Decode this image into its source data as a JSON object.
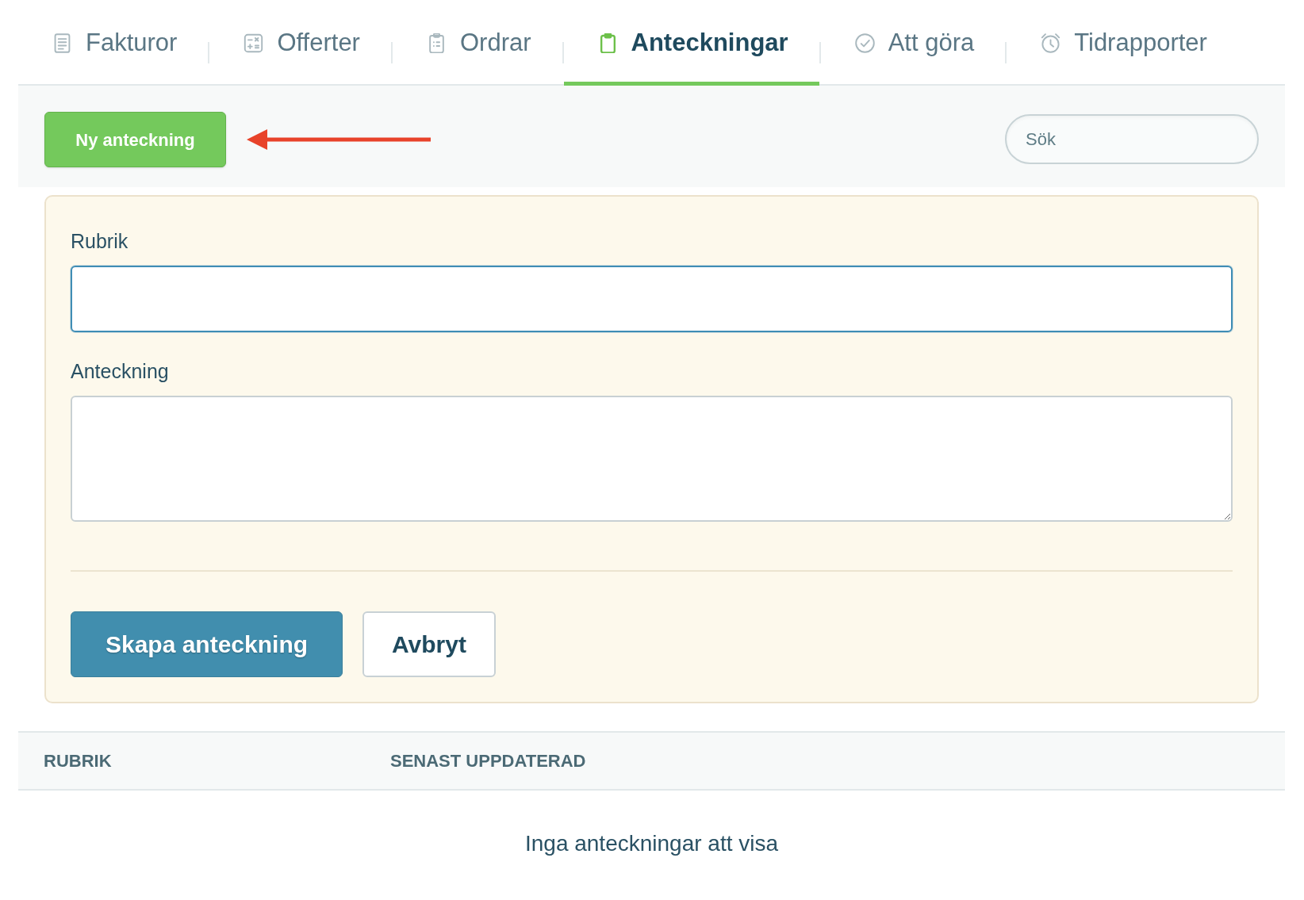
{
  "tabs": [
    {
      "label": "Fakturor",
      "selected": false
    },
    {
      "label": "Offerter",
      "selected": false
    },
    {
      "label": "Ordrar",
      "selected": false
    },
    {
      "label": "Anteckningar",
      "selected": true
    },
    {
      "label": "Att göra",
      "selected": false
    },
    {
      "label": "Tidrapporter",
      "selected": false
    }
  ],
  "new_note_button": {
    "label": "Ny anteckning"
  },
  "search": {
    "placeholder": "Sök"
  },
  "note_form": {
    "fields": [
      {
        "kind": "text",
        "label": "Rubrik",
        "focused": true
      },
      {
        "kind": "textarea",
        "label": "Anteckning",
        "focused": false
      }
    ],
    "buttons": [
      {
        "kind": "primary",
        "label": "Skapa anteckning"
      },
      {
        "kind": "secondary",
        "label": "Avbryt"
      }
    ]
  },
  "notes_table": {
    "columns": [
      "RUBRIK",
      "SENAST UPPDATERAD"
    ],
    "empty_message": "Inga anteckningar att visa"
  }
}
